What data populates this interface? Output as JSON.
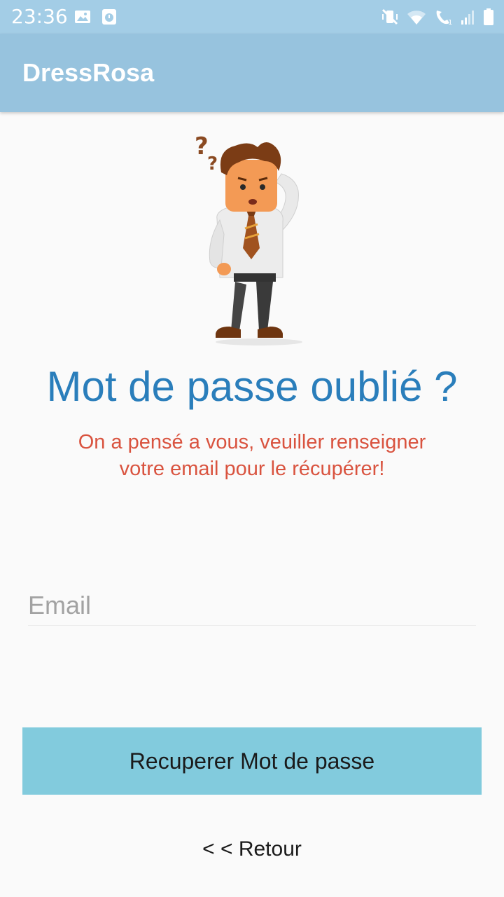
{
  "status_bar": {
    "time": "23:36",
    "left_icons": [
      "image-icon",
      "clock-notification-icon"
    ],
    "right_icons": [
      "vibrate-mute-icon",
      "wifi-icon",
      "wifi-call-icon",
      "signal-icon",
      "battery-icon"
    ],
    "background_color": "#a3cde6"
  },
  "app_bar": {
    "title": "DressRosa",
    "background_color": "#97c3de"
  },
  "illustration": {
    "icon": "confused-man-illustration"
  },
  "content": {
    "heading": "Mot de passe oublié ?",
    "subtitle_line1": "On a pensé a vous, veuiller renseigner",
    "subtitle_line2": "votre email pour le récupérer!",
    "heading_color": "#2a7ebb",
    "subtitle_color": "#d9533f"
  },
  "form": {
    "email_placeholder": "Email",
    "email_value": "",
    "submit_label": "Recuperer Mot de passe",
    "button_color": "#82cbdd"
  },
  "footer": {
    "back_label": "< < Retour"
  }
}
